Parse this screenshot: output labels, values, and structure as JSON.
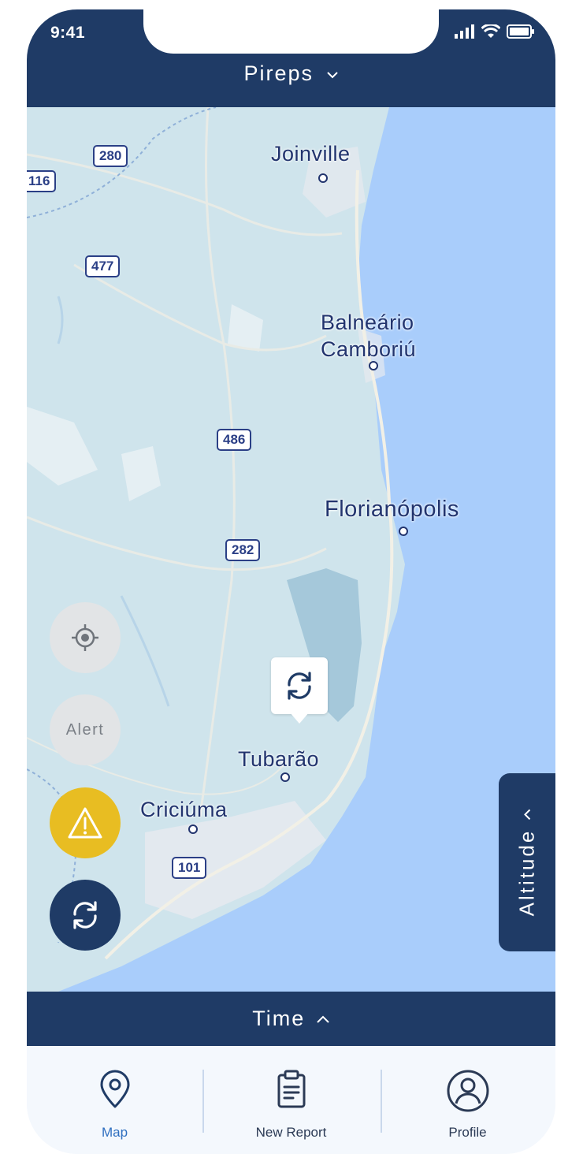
{
  "status_bar": {
    "time": "9:41"
  },
  "header": {
    "title": "Pireps"
  },
  "map": {
    "cities": [
      {
        "name": "Joinville"
      },
      {
        "name": "Balneário\nCamboriú"
      },
      {
        "name": "Florianópolis"
      },
      {
        "name": "Tubarão"
      },
      {
        "name": "Criciúma"
      }
    ],
    "road_shields": [
      "280",
      "116",
      "477",
      "486",
      "282",
      "101"
    ]
  },
  "controls": {
    "alert_label": "Alert",
    "altitude_label": "Altitude"
  },
  "time_bar": {
    "label": "Time"
  },
  "tabs": [
    {
      "label": "Map",
      "icon": "map-pin-icon",
      "active": true
    },
    {
      "label": "New Report",
      "icon": "clipboard-icon",
      "active": false
    },
    {
      "label": "Profile",
      "icon": "user-icon",
      "active": false
    }
  ],
  "colors": {
    "primary": "#1f3b66",
    "warning": "#e8bd22",
    "water": "#a9cdfb",
    "land": "#cfe4ec",
    "active_tab": "#2f6fc0"
  }
}
